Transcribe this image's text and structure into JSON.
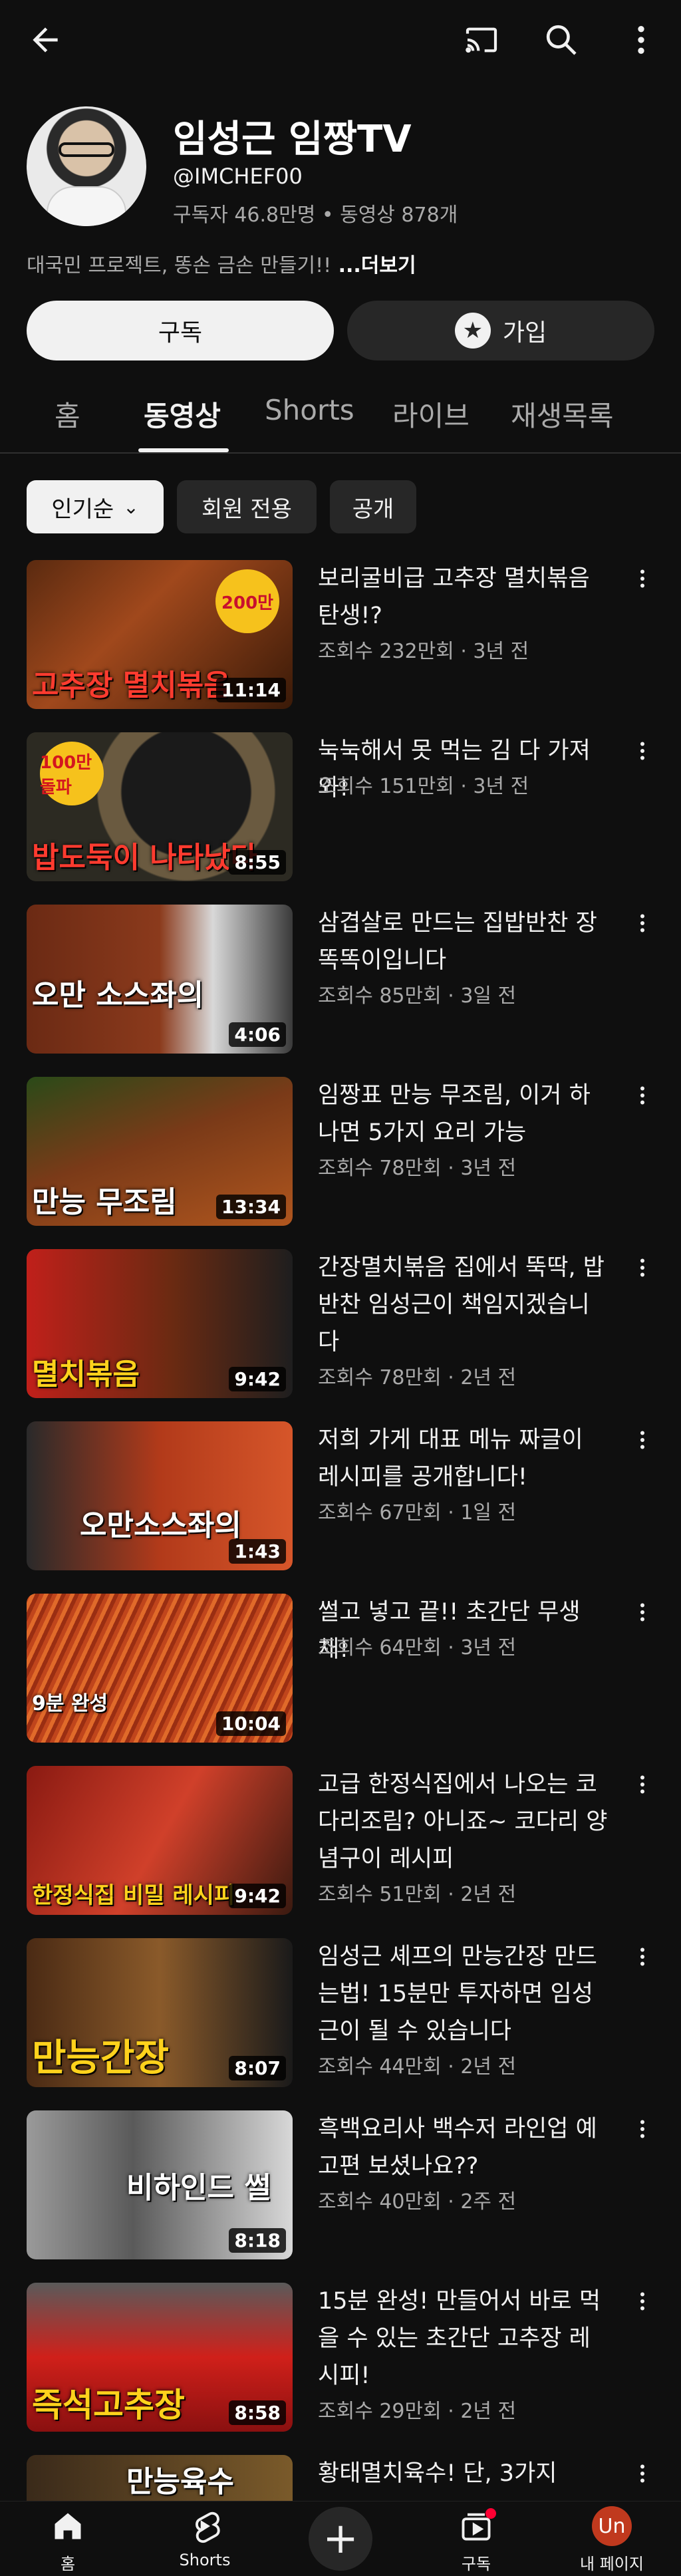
{
  "channel": {
    "name": "임성근 임짱TV",
    "handle": "@IMCHEF00",
    "stats": "구독자 46.8만명 • 동영상 878개",
    "description": "대국민 프로젝트, 똥손 금손 만들기!!",
    "more": " ...더보기"
  },
  "actions": {
    "subscribe": "구독",
    "join": "가입"
  },
  "tabs": [
    "홈",
    "동영상",
    "Shorts",
    "라이브",
    "재생목록"
  ],
  "chips": [
    "인기순",
    "회원 전용",
    "공개"
  ],
  "videos": [
    {
      "title": "보리굴비급 고추장 멸치볶음 탄생!?",
      "meta": "조회수 232만회 · 3년 전",
      "duration": "11:14",
      "thumb_text": "고추장 멸치볶음",
      "sticker": "200만"
    },
    {
      "title": "눅눅해서 못 먹는 김 다 가져와!",
      "meta": "조회수 151만회 · 3년 전",
      "duration": "8:55",
      "thumb_text": "밥도둑이 나타났다",
      "sticker": "100만 돌파"
    },
    {
      "title": "삼겹살로 만드는 집밥반찬 장똑똑이입니다",
      "meta": "조회수 85만회 · 3일 전",
      "duration": "4:06",
      "thumb_text": "오만 소스좌의"
    },
    {
      "title": "임짱표 만능 무조림, 이거 하나면 5가지 요리 가능",
      "meta": "조회수 78만회 · 3년 전",
      "duration": "13:34",
      "thumb_text": "만능 무조림"
    },
    {
      "title": "간장멸치볶음 집에서 뚝딱, 밥반찬 임성근이 책임지겠습니다",
      "meta": "조회수 78만회 · 2년 전",
      "duration": "9:42",
      "thumb_text": "멸치볶음"
    },
    {
      "title": "저희 가게 대표 메뉴 짜글이 레시피를 공개합니다!",
      "meta": "조회수 67만회 · 1일 전",
      "duration": "1:43",
      "thumb_text": "오만소스좌의"
    },
    {
      "title": "썰고 넣고 끝!! 초간단 무생채!",
      "meta": "조회수 64만회 · 3년 전",
      "duration": "10:04",
      "thumb_text": "9분 완성"
    },
    {
      "title": "고급 한정식집에서 나오는 코다리조림? 아니죠~ 코다리 양념구이 레시피",
      "meta": "조회수 51만회 · 2년 전",
      "duration": "9:42",
      "thumb_text": "한정식집 비밀 레시피"
    },
    {
      "title": "임성근 셰프의 만능간장 만드는법! 15분만 투자하면 임성근이 될 수 있습니다",
      "meta": "조회수 44만회 · 2년 전",
      "duration": "8:07",
      "thumb_text": "만능간장"
    },
    {
      "title": "흑백요리사 백수저 라인업 예고편 보셨나요??",
      "meta": "조회수 40만회 · 2주 전",
      "duration": "8:18",
      "thumb_text": "비하인드 썰"
    },
    {
      "title": "15분 완성! 만들어서 바로 먹을 수 있는 초간단 고추장 레시피!",
      "meta": "조회수 29만회 · 2년 전",
      "duration": "8:58",
      "thumb_text": "즉석고추장"
    },
    {
      "title": "황태멸치육수! 단, 3가지",
      "meta": "",
      "duration": "",
      "thumb_text": "만능육수"
    }
  ],
  "nav": [
    {
      "label": "홈",
      "icon": "home-icon"
    },
    {
      "label": "Shorts",
      "icon": "shorts-icon"
    },
    {
      "label": "",
      "icon": "create-icon"
    },
    {
      "label": "구독",
      "icon": "subscriptions-icon"
    },
    {
      "label": "내 페이지",
      "icon": "avatar",
      "avatar_text": "Un"
    }
  ],
  "colors": {
    "background": "#0f0f0f",
    "secondary_text": "#aaaaaa",
    "chip_bg": "#272727",
    "notification": "#ff0033"
  }
}
